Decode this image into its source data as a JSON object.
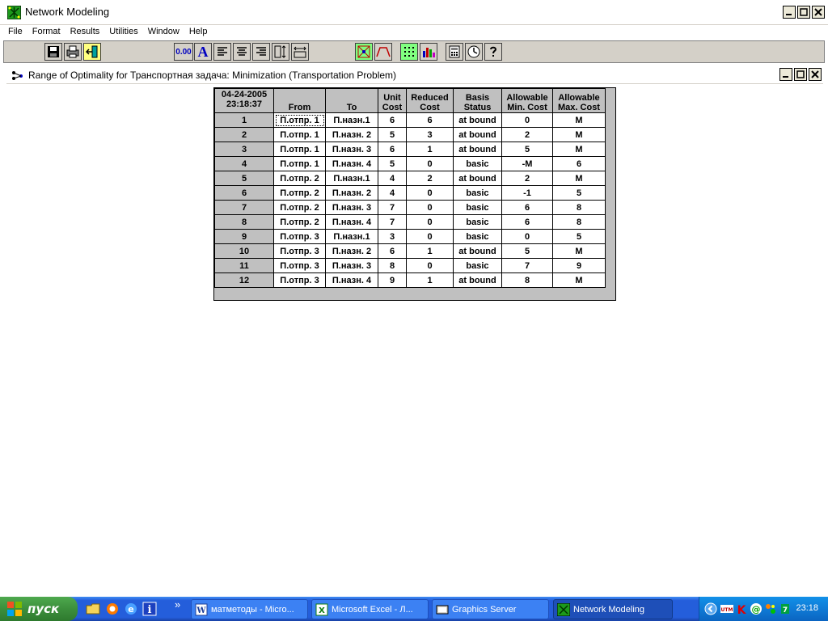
{
  "window": {
    "title": "Network Modeling"
  },
  "menu": [
    "File",
    "Format",
    "Results",
    "Utilities",
    "Window",
    "Help"
  ],
  "toolbar": {
    "decimal_label": "0.00",
    "font_label": "A"
  },
  "child_window": {
    "title": "Range of Optimality for Транспортная задача: Minimization (Transportation Problem)"
  },
  "table": {
    "corner_date": "04-24-2005",
    "corner_time": "23:18:37",
    "headers": [
      [
        "",
        "From"
      ],
      [
        "",
        "To"
      ],
      [
        "Unit",
        "Cost"
      ],
      [
        "Reduced",
        "Cost"
      ],
      [
        "Basis",
        "Status"
      ],
      [
        "Allowable",
        "Min. Cost"
      ],
      [
        "Allowable",
        "Max. Cost"
      ]
    ],
    "rows": [
      [
        "1",
        "П.отпр. 1",
        "П.назн.1",
        "6",
        "6",
        "at bound",
        "0",
        "M"
      ],
      [
        "2",
        "П.отпр. 1",
        "П.назн. 2",
        "5",
        "3",
        "at bound",
        "2",
        "M"
      ],
      [
        "3",
        "П.отпр. 1",
        "П.назн. 3",
        "6",
        "1",
        "at bound",
        "5",
        "M"
      ],
      [
        "4",
        "П.отпр. 1",
        "П.назн. 4",
        "5",
        "0",
        "basic",
        "-M",
        "6"
      ],
      [
        "5",
        "П.отпр. 2",
        "П.назн.1",
        "4",
        "2",
        "at bound",
        "2",
        "M"
      ],
      [
        "6",
        "П.отпр. 2",
        "П.назн. 2",
        "4",
        "0",
        "basic",
        "-1",
        "5"
      ],
      [
        "7",
        "П.отпр. 2",
        "П.назн. 3",
        "7",
        "0",
        "basic",
        "6",
        "8"
      ],
      [
        "8",
        "П.отпр. 2",
        "П.назн. 4",
        "7",
        "0",
        "basic",
        "6",
        "8"
      ],
      [
        "9",
        "П.отпр. 3",
        "П.назн.1",
        "3",
        "0",
        "basic",
        "0",
        "5"
      ],
      [
        "10",
        "П.отпр. 3",
        "П.назн. 2",
        "6",
        "1",
        "at bound",
        "5",
        "M"
      ],
      [
        "11",
        "П.отпр. 3",
        "П.назн. 3",
        "8",
        "0",
        "basic",
        "7",
        "9"
      ],
      [
        "12",
        "П.отпр. 3",
        "П.назн. 4",
        "9",
        "1",
        "at bound",
        "8",
        "M"
      ]
    ]
  },
  "taskbar": {
    "start_label": "пуск",
    "overflow": "»",
    "tasks": [
      {
        "label": "матметоды - Micro...",
        "icon": "word-icon"
      },
      {
        "label": "Microsoft Excel - Л...",
        "icon": "excel-icon"
      },
      {
        "label": "Graphics Server",
        "icon": "graphics-server-icon"
      },
      {
        "label": "Network Modeling",
        "icon": "network-modeling-icon"
      }
    ],
    "clock": "23:18"
  },
  "colors": {
    "toolbar_bg": "#d4d0c8",
    "grid_header_bg": "#c0c0c0",
    "taskbar_blue": "#245edb",
    "start_green": "#3c8f3c"
  }
}
